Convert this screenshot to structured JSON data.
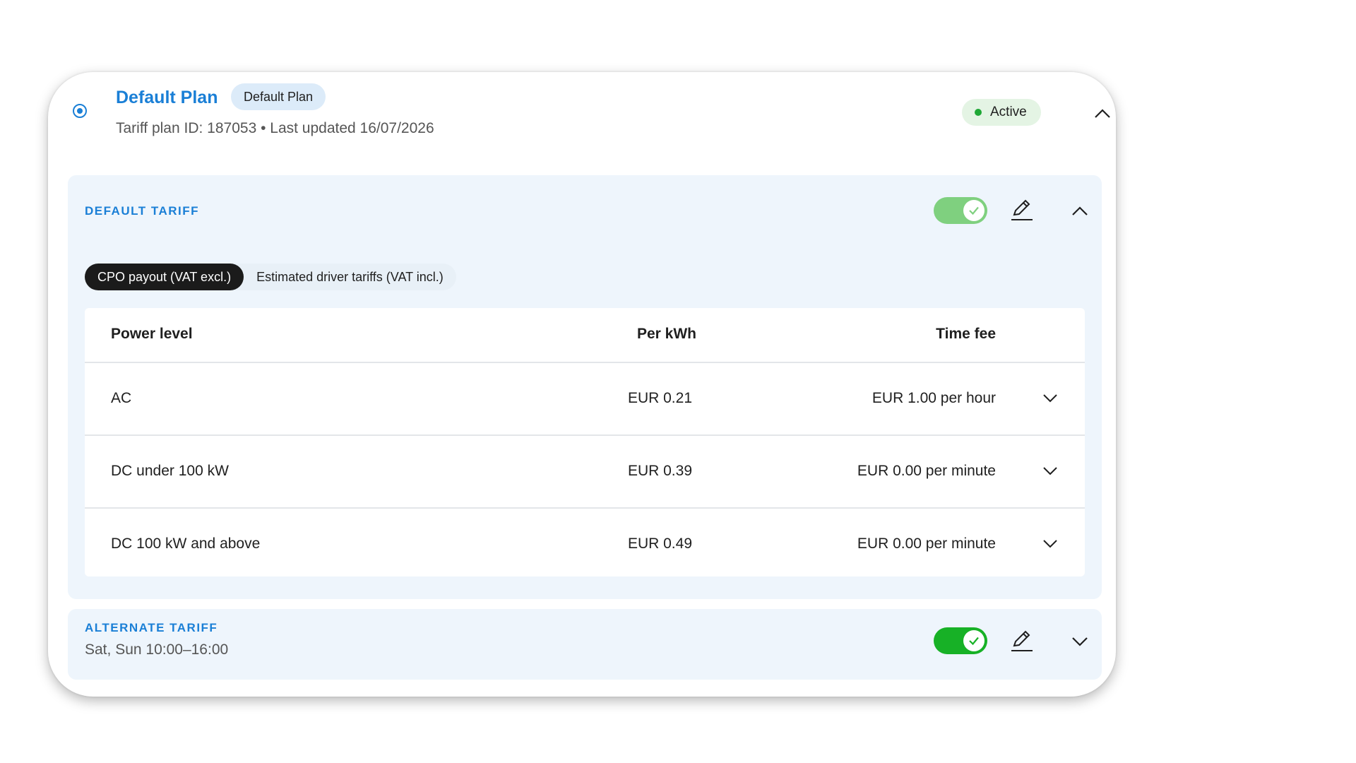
{
  "plan": {
    "title": "Default Plan",
    "chip": "Default Plan",
    "meta": "Tariff plan ID: 187053 • Last updated 16/07/2026",
    "status": "Active",
    "status_color": "#1fa836",
    "accent": "#1a7fd6"
  },
  "default_tariff": {
    "label": "DEFAULT TARIFF",
    "enabled": true,
    "toggle_color": "#7fd07f",
    "tabs": [
      {
        "label": "CPO payout (VAT excl.)",
        "active": true
      },
      {
        "label": "Estimated driver tariffs (VAT incl.)",
        "active": false
      }
    ],
    "table": {
      "headers": {
        "power": "Power level",
        "kwh": "Per kWh",
        "time": "Time fee"
      },
      "rows": [
        {
          "power": "AC",
          "kwh": "EUR 0.21",
          "time": "EUR 1.00 per hour"
        },
        {
          "power": "DC under 100 kW",
          "kwh": "EUR 0.39",
          "time": "EUR 0.00 per minute"
        },
        {
          "power": "DC 100 kW and above",
          "kwh": "EUR 0.49",
          "time": "EUR 0.00 per minute"
        }
      ]
    }
  },
  "alternate_tariff": {
    "label": "ALTERNATE TARIFF",
    "schedule": "Sat, Sun 10:00–16:00",
    "enabled": true,
    "toggle_color": "#17b126"
  },
  "icons": {
    "collapse": "chevron-up-icon",
    "expand": "chevron-down-icon",
    "edit": "pencil-icon",
    "check": "check-icon"
  }
}
